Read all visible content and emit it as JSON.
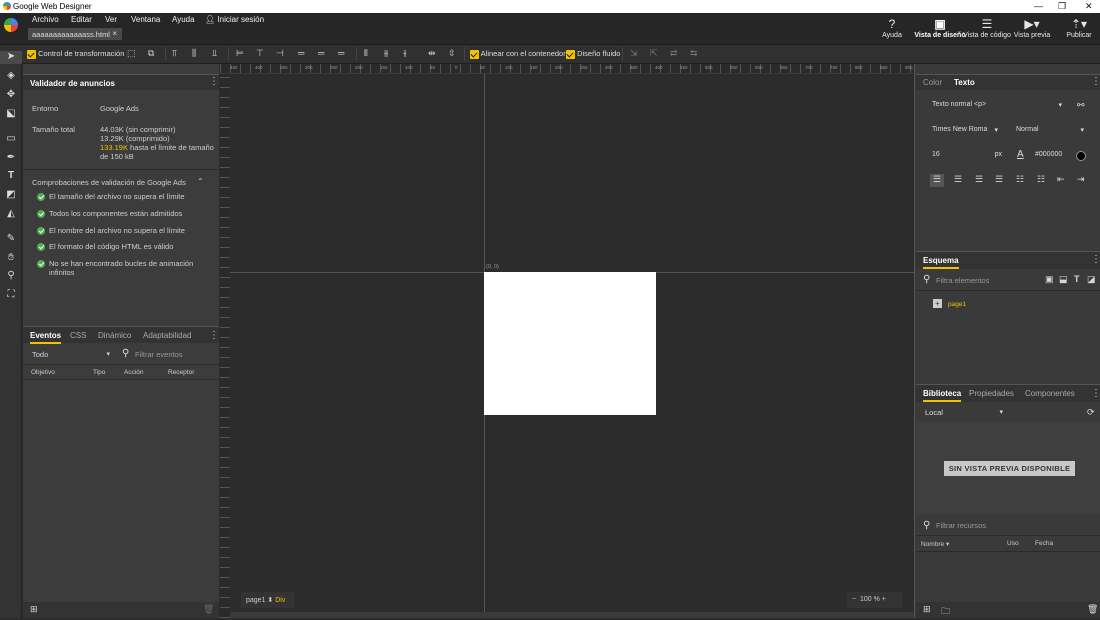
{
  "app": {
    "title": "Google Web Designer"
  },
  "menu": [
    "Archivo",
    "Editar",
    "Ver",
    "Ventana",
    "Ayuda"
  ],
  "signin": "Iniciar sesión",
  "file_tab": "aaaaaaaaaaaaass.html",
  "top_buttons": {
    "help": "Ayuda",
    "design_view": "Vista de diseño",
    "code_view": "Vista de código",
    "preview": "Vista previa",
    "publish": "Publicar"
  },
  "toolbar": {
    "transform_control": "Control de transformación",
    "align_container": "Alinear con el contenedor",
    "fluid_design": "Diseño fluido"
  },
  "ad_validator": {
    "title": "Validador de anuncios",
    "env_label": "Entorno",
    "env_value": "Google Ads",
    "size_label": "Tamaño total",
    "size_uncompressed": "44.03K (sin comprimir)",
    "size_compressed": "13.29K (comprimido)",
    "size_limit_value": "133.19K",
    "size_limit_text": " hasta el límite de tamaño de 150 kB",
    "checks_title": "Comprobaciones de validación de Google Ads",
    "checks": [
      "El tamaño del archivo no supera el límite",
      "Todos los componentes están admitidos",
      "El nombre del archivo no supera el límite",
      "El formato del código HTML es válido",
      "No se han encontrado bucles de animación infinitos"
    ]
  },
  "events": {
    "tabs": [
      "Eventos",
      "CSS",
      "Dinámico",
      "Adaptabilidad"
    ],
    "filter_value": "Todo",
    "filter_placeholder": "Filtrar eventos",
    "columns": [
      "Objetivo",
      "Tipo",
      "Acción",
      "Receptor"
    ]
  },
  "canvas": {
    "origin": "(0, 0)",
    "ruler_ticks": [
      "450",
      "400",
      "350",
      "300",
      "250",
      "200",
      "150",
      "100",
      "50",
      "0",
      "50",
      "100",
      "150",
      "200",
      "250",
      "300",
      "350",
      "400",
      "450",
      "500",
      "550",
      "600",
      "650",
      "700",
      "750",
      "800",
      "850",
      "900"
    ],
    "breadcrumb_page": "page1",
    "breadcrumb_el": "Div",
    "zoom": "100 %"
  },
  "text_panel": {
    "tabs": [
      "Color",
      "Texto"
    ],
    "style": "Texto normal <p>",
    "font": "Times New Roma",
    "weight": "Normal",
    "size": "16",
    "unit": "px",
    "color": "#000000"
  },
  "outline": {
    "title": "Esquema",
    "filter_placeholder": "Filtra elementos",
    "page": "page1"
  },
  "library": {
    "tabs": [
      "Biblioteca",
      "Propiedades",
      "Componentes"
    ],
    "source": "Local",
    "no_preview": "SIN VISTA PREVIA DISPONIBLE",
    "filter_placeholder": "Filtrar recursos",
    "columns": [
      "Nombre",
      "Uso",
      "Fecha"
    ]
  },
  "colors": {
    "accent": "#f2c200",
    "ok": "#4caf50",
    "warn": "#f2c200"
  }
}
